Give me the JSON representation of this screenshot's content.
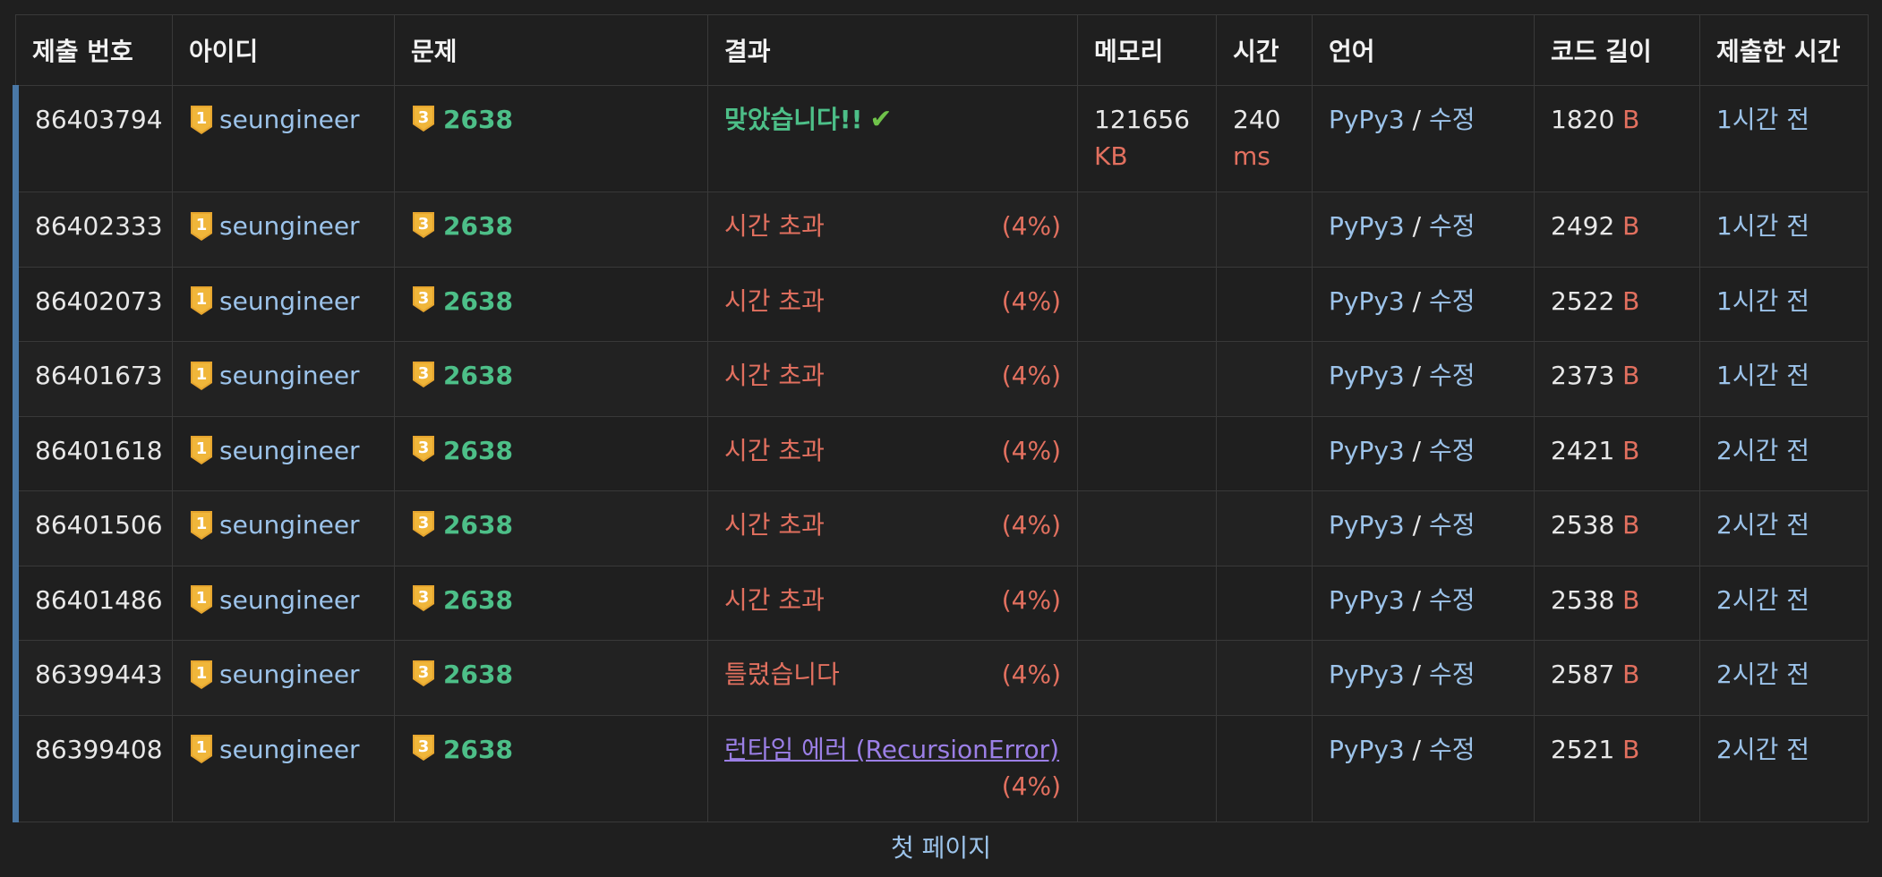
{
  "headers": {
    "submission_id": "제출 번호",
    "user_id": "아이디",
    "problem": "문제",
    "result": "결과",
    "memory": "메모리",
    "time": "시간",
    "language": "언어",
    "code_length": "코드 길이",
    "submitted_at": "제출한 시간"
  },
  "rows": [
    {
      "id": "86403794",
      "user": "seungineer",
      "user_tier_badge": "1",
      "problem": "2638",
      "problem_tier_badge": "3",
      "result": "맞았습니다!!",
      "result_type": "accepted",
      "percent": "",
      "memory": "121656",
      "memory_unit": "KB",
      "time": "240",
      "time_unit": "ms",
      "language": "PyPy3",
      "slash": "/",
      "edit": "수정",
      "code_length": "1820",
      "code_unit": "B",
      "submitted": "1시간 전"
    },
    {
      "id": "86402333",
      "user": "seungineer",
      "user_tier_badge": "1",
      "problem": "2638",
      "problem_tier_badge": "3",
      "result": "시간 초과",
      "result_type": "tle",
      "percent": "(4%)",
      "memory": "",
      "memory_unit": "",
      "time": "",
      "time_unit": "",
      "language": "PyPy3",
      "slash": "/",
      "edit": "수정",
      "code_length": "2492",
      "code_unit": "B",
      "submitted": "1시간 전"
    },
    {
      "id": "86402073",
      "user": "seungineer",
      "user_tier_badge": "1",
      "problem": "2638",
      "problem_tier_badge": "3",
      "result": "시간 초과",
      "result_type": "tle",
      "percent": "(4%)",
      "memory": "",
      "memory_unit": "",
      "time": "",
      "time_unit": "",
      "language": "PyPy3",
      "slash": "/",
      "edit": "수정",
      "code_length": "2522",
      "code_unit": "B",
      "submitted": "1시간 전"
    },
    {
      "id": "86401673",
      "user": "seungineer",
      "user_tier_badge": "1",
      "problem": "2638",
      "problem_tier_badge": "3",
      "result": "시간 초과",
      "result_type": "tle",
      "percent": "(4%)",
      "memory": "",
      "memory_unit": "",
      "time": "",
      "time_unit": "",
      "language": "PyPy3",
      "slash": "/",
      "edit": "수정",
      "code_length": "2373",
      "code_unit": "B",
      "submitted": "1시간 전"
    },
    {
      "id": "86401618",
      "user": "seungineer",
      "user_tier_badge": "1",
      "problem": "2638",
      "problem_tier_badge": "3",
      "result": "시간 초과",
      "result_type": "tle",
      "percent": "(4%)",
      "memory": "",
      "memory_unit": "",
      "time": "",
      "time_unit": "",
      "language": "PyPy3",
      "slash": "/",
      "edit": "수정",
      "code_length": "2421",
      "code_unit": "B",
      "submitted": "2시간 전"
    },
    {
      "id": "86401506",
      "user": "seungineer",
      "user_tier_badge": "1",
      "problem": "2638",
      "problem_tier_badge": "3",
      "result": "시간 초과",
      "result_type": "tle",
      "percent": "(4%)",
      "memory": "",
      "memory_unit": "",
      "time": "",
      "time_unit": "",
      "language": "PyPy3",
      "slash": "/",
      "edit": "수정",
      "code_length": "2538",
      "code_unit": "B",
      "submitted": "2시간 전"
    },
    {
      "id": "86401486",
      "user": "seungineer",
      "user_tier_badge": "1",
      "problem": "2638",
      "problem_tier_badge": "3",
      "result": "시간 초과",
      "result_type": "tle",
      "percent": "(4%)",
      "memory": "",
      "memory_unit": "",
      "time": "",
      "time_unit": "",
      "language": "PyPy3",
      "slash": "/",
      "edit": "수정",
      "code_length": "2538",
      "code_unit": "B",
      "submitted": "2시간 전"
    },
    {
      "id": "86399443",
      "user": "seungineer",
      "user_tier_badge": "1",
      "problem": "2638",
      "problem_tier_badge": "3",
      "result": "틀렸습니다",
      "result_type": "wrong",
      "percent": "(4%)",
      "memory": "",
      "memory_unit": "",
      "time": "",
      "time_unit": "",
      "language": "PyPy3",
      "slash": "/",
      "edit": "수정",
      "code_length": "2587",
      "code_unit": "B",
      "submitted": "2시간 전"
    },
    {
      "id": "86399408",
      "user": "seungineer",
      "user_tier_badge": "1",
      "problem": "2638",
      "problem_tier_badge": "3",
      "result": "런타임 에러 (RecursionError)",
      "result_type": "runtime",
      "percent": "(4%)",
      "memory": "",
      "memory_unit": "",
      "time": "",
      "time_unit": "",
      "language": "PyPy3",
      "slash": "/",
      "edit": "수정",
      "code_length": "2521",
      "code_unit": "B",
      "submitted": "2시간 전"
    }
  ],
  "footer": {
    "first_page": "첫 페이지"
  },
  "colors": {
    "background": "#1f1f1f",
    "accepted": "#4dbf88",
    "error": "#e2705f",
    "runtime": "#9b7fe6",
    "link": "#9cc3ea",
    "row_marker": "#4a78a6",
    "tier_gold": "#e6a52e"
  }
}
